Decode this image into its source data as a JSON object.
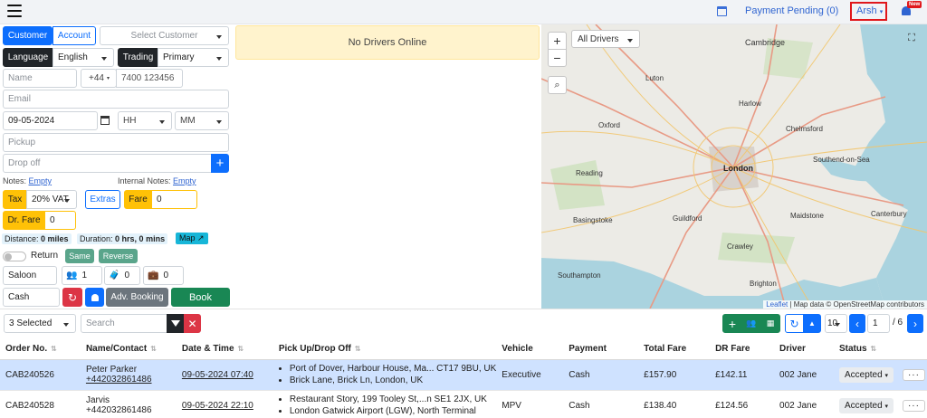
{
  "header": {
    "payment_pending": "Payment Pending (0)",
    "user": "Arsh",
    "new_badge": "New"
  },
  "form": {
    "customer_tab": "Customer",
    "account_tab": "Account",
    "select_customer": "Select Customer",
    "language_label": "Language",
    "language_value": "English",
    "trading_label": "Trading",
    "trading_value": "Primary",
    "name_ph": "Name",
    "country_code": "+44",
    "phone_ph": "7400 123456",
    "email_ph": "Email",
    "date_value": "09-05-2024",
    "hh": "HH",
    "mm": "MM",
    "pickup_ph": "Pickup",
    "dropoff_ph": "Drop off",
    "notes_label": "Notes:",
    "notes_value": "Empty",
    "internal_notes_label": "Internal Notes:",
    "internal_notes_value": "Empty",
    "tax_label": "Tax",
    "tax_value": "20% VAT",
    "extras": "Extras",
    "fare_label": "Fare",
    "fare_value": "0",
    "drfare_label": "Dr. Fare",
    "drfare_value": "0",
    "distance_label": "Distance:",
    "distance_value": "0 miles",
    "duration_label": "Duration:",
    "duration_value": "0 hrs, 0 mins",
    "map_btn": "Map",
    "return_label": "Return",
    "same": "Same",
    "reverse": "Reverse",
    "vehicle": "Saloon",
    "passengers": "1",
    "luggage": "0",
    "hand_luggage": "0",
    "payment": "Cash",
    "adv_booking": "Adv. Booking",
    "book": "Book"
  },
  "drivers_banner": "No Drivers Online",
  "map": {
    "filter": "All Drivers",
    "zoom_in": "+",
    "zoom_out": "−",
    "attribution_leaflet": "Leaflet",
    "attribution_text": "| Map data © OpenStreetMap contributors",
    "places": [
      "Cambridge",
      "Luton",
      "Oxford",
      "Harlow",
      "Chelmsford",
      "London",
      "Southend-on-Sea",
      "Maidstone",
      "Canterbury",
      "Guildford",
      "Crawley",
      "Brighton",
      "Southampton",
      "Basingstoke",
      "Reading"
    ]
  },
  "toolbar": {
    "selected": "3 Selected",
    "search_ph": "Search",
    "page_size": "10",
    "page": "1",
    "page_total": "/ 6"
  },
  "table": {
    "headers": [
      "Order No.",
      "Name/Contact",
      "Date & Time",
      "Pick Up/Drop Off",
      "Vehicle",
      "Payment",
      "Total Fare",
      "DR Fare",
      "Driver",
      "Status"
    ],
    "rows": [
      {
        "order": "CAB240526",
        "name": "Peter Parker",
        "contact": "+442032861486",
        "datetime": "09-05-2024 07:40",
        "pickup": "Port of Dover, Harbour House, Ma... CT17 9BU, UK",
        "dropoff": "Brick Lane, Brick Ln, London, UK",
        "vehicle": "Executive",
        "payment": "Cash",
        "total": "£157.90",
        "dr": "£142.11",
        "driver": "002 Jane",
        "status": "Accepted"
      },
      {
        "order": "CAB240528",
        "name": "Jarvis",
        "contact": "+442032861486",
        "datetime": "09-05-2024 22:10",
        "pickup": "Restaurant Story, 199 Tooley St,...n SE1 2JX, UK",
        "dropoff": "London Gatwick Airport (LGW), North Terminal",
        "vehicle": "MPV",
        "payment": "Cash",
        "total": "£138.40",
        "dr": "£124.56",
        "driver": "002 Jane",
        "status": "Accepted"
      }
    ]
  }
}
